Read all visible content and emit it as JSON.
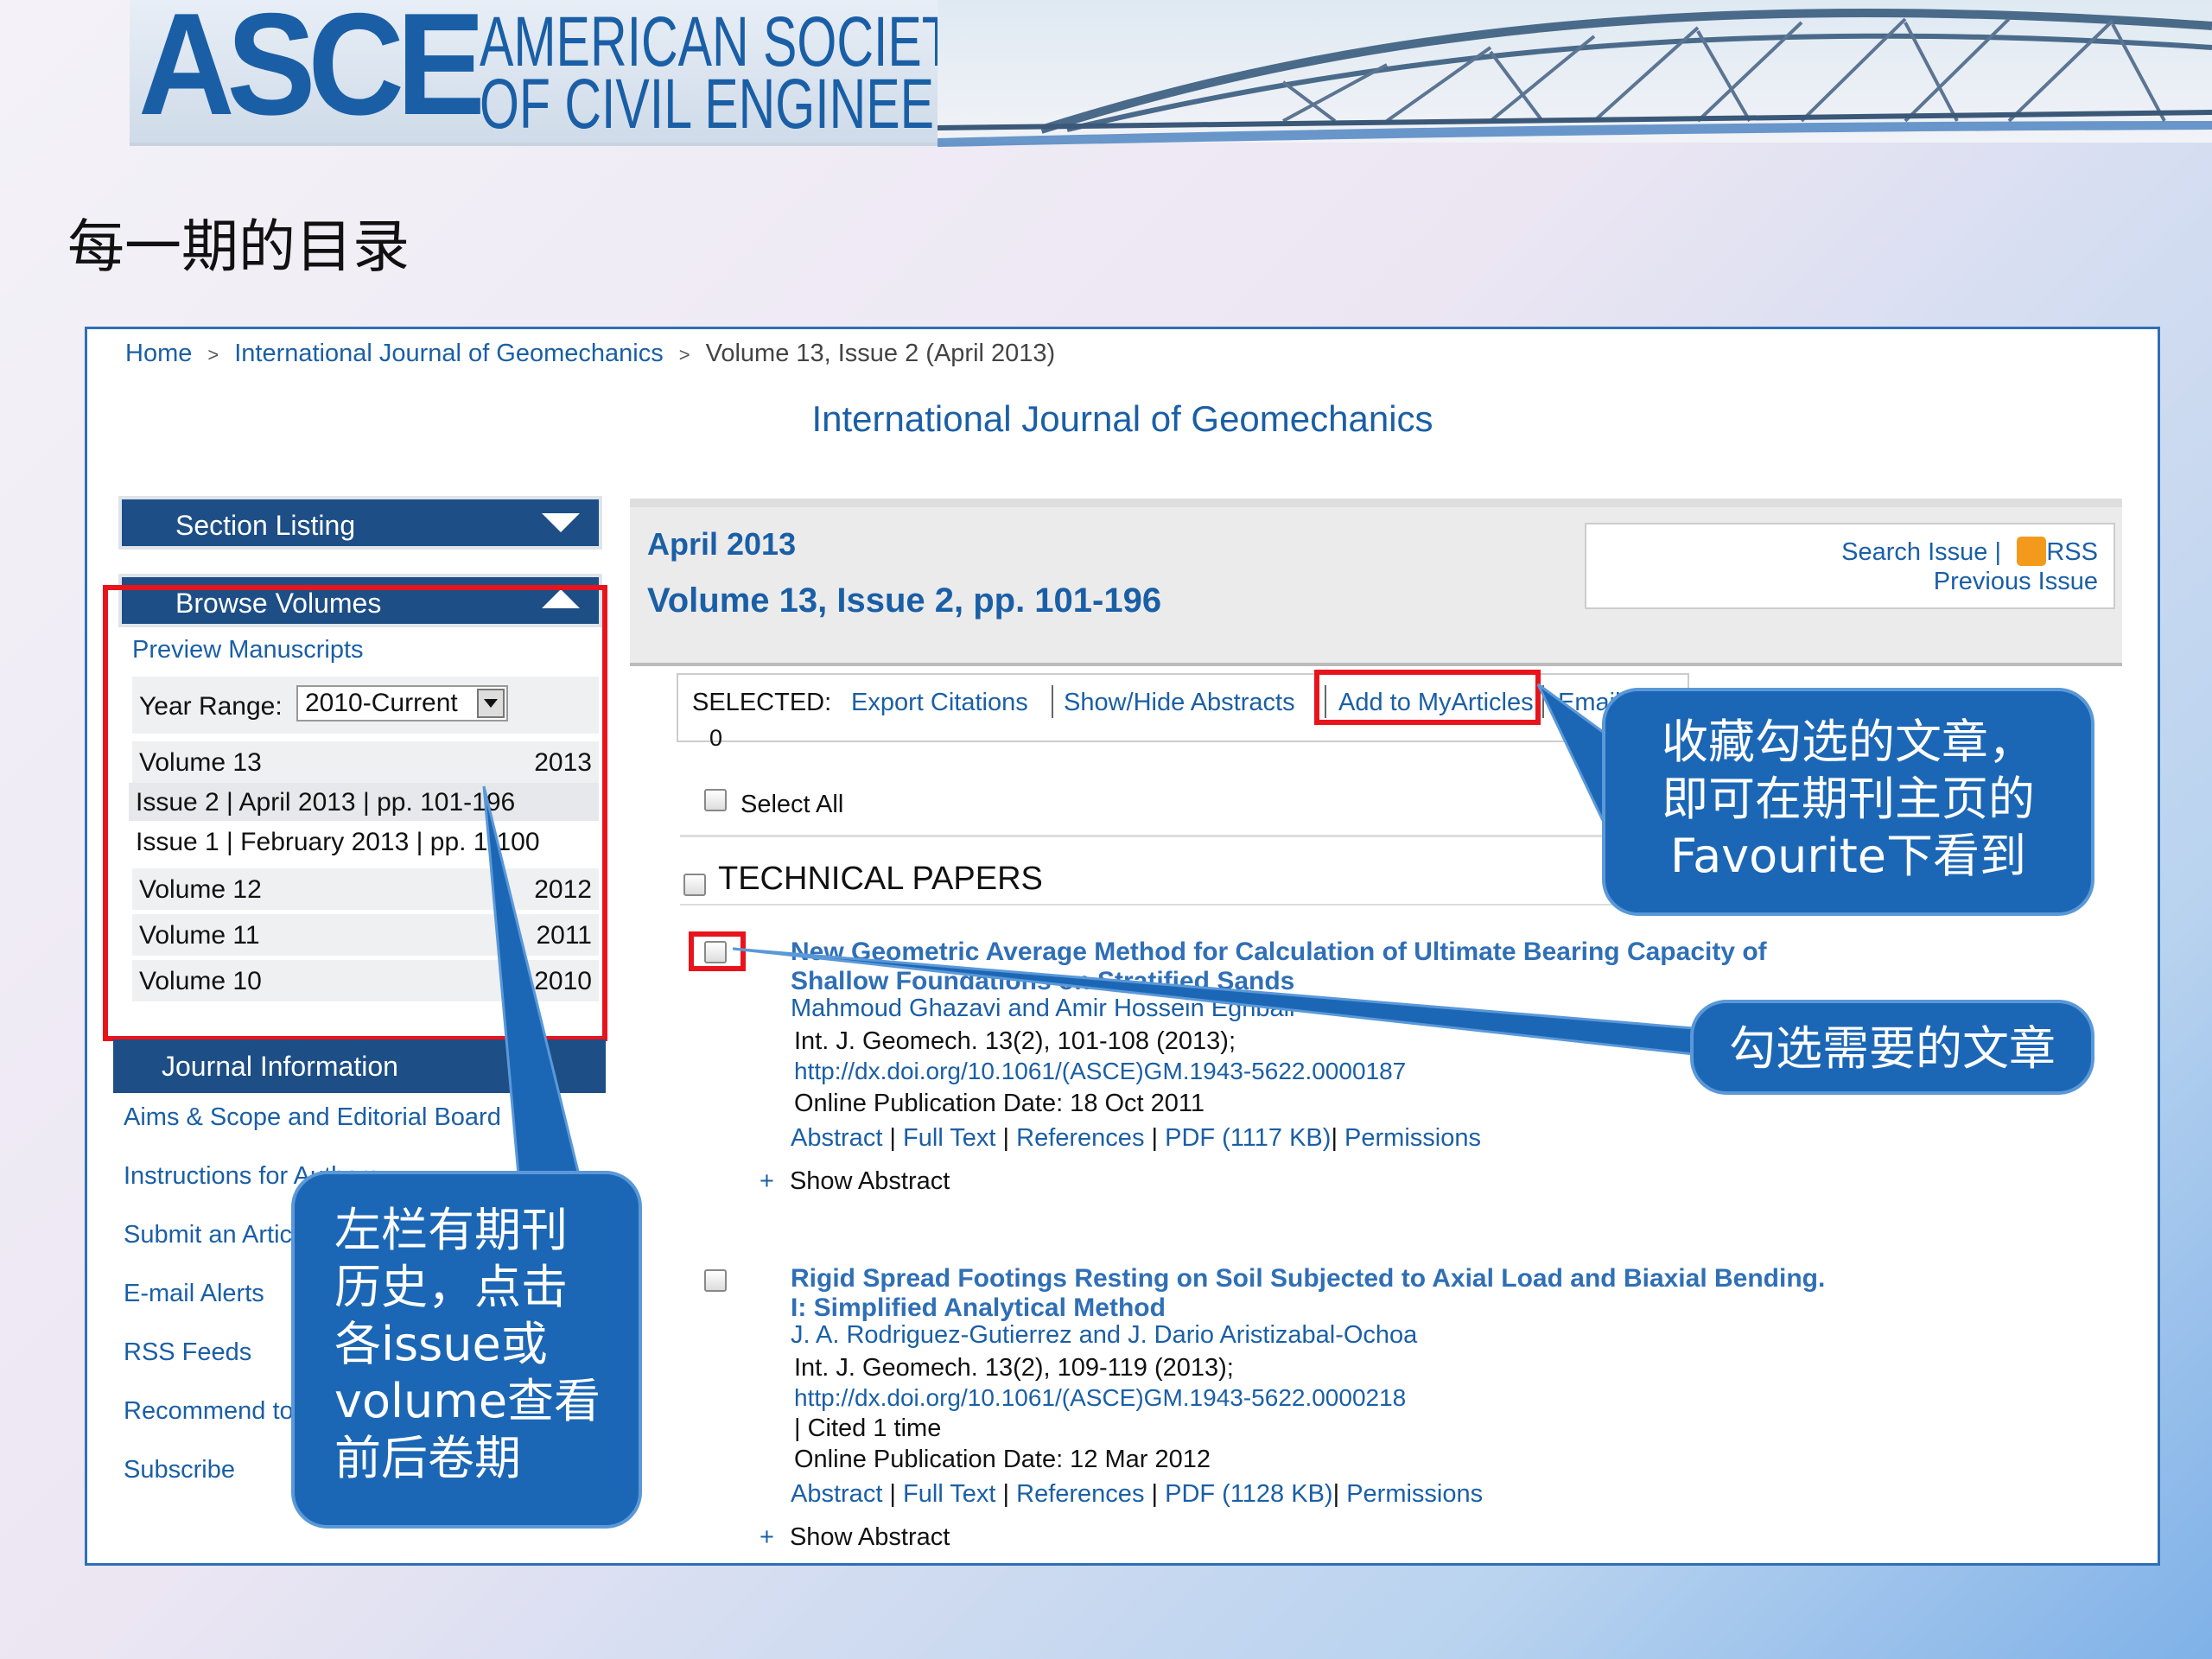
{
  "banner": {
    "logo_text": "ASCE",
    "org_line1": "AMERICAN SOCIETY",
    "org_line2": "OF CIVIL ENGINEERS"
  },
  "slide_title": "每一期的目录",
  "breadcrumb": {
    "home": "Home",
    "journal": "International Journal of Geomechanics",
    "current": "Volume 13, Issue 2 (April 2013)",
    "separator": ">"
  },
  "journal_title": "International Journal of Geomechanics",
  "sidebar": {
    "section_listing": "Section Listing",
    "browse_volumes": "Browse Volumes",
    "preview_manuscripts": "Preview Manuscripts",
    "year_range_label": "Year Range:",
    "year_range_value": "2010-Current",
    "volumes": [
      {
        "name": "Volume 13",
        "year": "2013"
      },
      {
        "name": "Volume 12",
        "year": "2012"
      },
      {
        "name": "Volume 11",
        "year": "2011"
      },
      {
        "name": "Volume 10",
        "year": "2010"
      }
    ],
    "issues": [
      {
        "label": "Issue 2 | April 2013 | pp. 101-196"
      },
      {
        "label": "Issue 1 | February 2013 | pp. 1-100"
      }
    ],
    "journal_information": "Journal Information",
    "journal_links": [
      "Aims & Scope and Editorial Board",
      "Instructions for Authors",
      "Submit an Article",
      "E-mail Alerts",
      "RSS Feeds",
      "Recommend to",
      "Subscribe"
    ]
  },
  "issue": {
    "date": "April 2013",
    "volume": "Volume 13, Issue 2, pp. 101-196",
    "search_issue": "Search Issue |",
    "rss": "RSS",
    "previous_issue": "Previous Issue"
  },
  "selection": {
    "label": "SELECTED:",
    "count": "0",
    "export_citations": "Export Citations",
    "show_hide_abstracts": "Show/Hide Abstracts",
    "add_to_myarticles": "Add to MyArticles",
    "email": "Email",
    "select_all": "Select All"
  },
  "section_heading": "TECHNICAL PAPERS",
  "articles": [
    {
      "title": "New Geometric Average Method for Calculation of Ultimate Bearing Capacity of Shallow Foundations on Stratified Sands",
      "authors": "Mahmoud Ghazavi and Amir Hossein Eghbali",
      "citation": "Int. J. Geomech. 13(2), 101-108 (2013);",
      "doi": "http://dx.doi.org/10.1061/(ASCE)GM.1943-5622.0000187",
      "cited": "",
      "pub_date": "Online Publication Date: 18 Oct 2011",
      "pdf": "PDF (1117 KB)"
    },
    {
      "title": "Rigid Spread Footings Resting on Soil Subjected to Axial Load and Biaxial Bending. I: Simplified Analytical Method",
      "authors": "J. A. Rodriguez-Gutierrez and J. Dario Aristizabal-Ochoa",
      "citation": "Int. J. Geomech. 13(2), 109-119 (2013);",
      "doi": "http://dx.doi.org/10.1061/(ASCE)GM.1943-5622.0000218",
      "cited": "| Cited 1 time",
      "pub_date": "Online Publication Date: 12 Mar 2012",
      "pdf": "PDF (1128 KB)"
    }
  ],
  "article_links": {
    "abstract": "Abstract",
    "full_text": "Full Text",
    "references": "References",
    "permissions": "Permissions",
    "show_abstract": "Show Abstract",
    "plus": "+"
  },
  "callouts": {
    "favourite": "收藏勾选的文章，\n即可在期刊主页的\nFavourite下看到",
    "select": "勾选需要的文章",
    "history": "左栏有期刊\n历史，点击\n各issue或\nvolume查看\n前后卷期"
  },
  "colors": {
    "brand_blue": "#1a5fa6",
    "nav_dark": "#1d4e86",
    "highlight_red": "#e8141c",
    "callout_blue": "#1c67b5"
  }
}
